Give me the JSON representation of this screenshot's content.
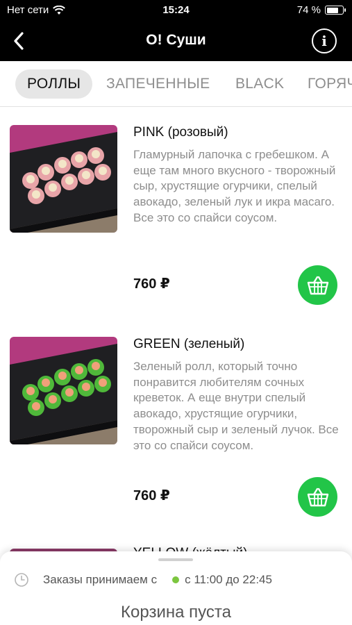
{
  "status_bar": {
    "carrier": "Нет сети",
    "time": "15:24",
    "battery": "74 %",
    "battery_level": 0.74
  },
  "nav": {
    "title": "O! Суши"
  },
  "tabs": [
    {
      "label": "РОЛЛЫ",
      "active": true
    },
    {
      "label": "ЗАПЕЧЕННЫЕ",
      "active": false
    },
    {
      "label": "BLACK",
      "active": false
    },
    {
      "label": "ГОРЯЧ",
      "active": false
    }
  ],
  "products": [
    {
      "name": "PINK (розовый)",
      "description": "Гламурный лапочка с гребешком. А еще там много вкусного - творожный сыр, хрустящие огурчики, спелый авокадо, зеленый лук и икра масаго. Все это со спайси соусом.",
      "price": "760 ₽",
      "roll_color": "#e8a4a8",
      "bg_color": "#b23a7e"
    },
    {
      "name": "GREEN (зеленый)",
      "description": "Зеленый ролл, который точно понравится любителям сочных креветок. А еще внутри спелый авокадо, хрустящие огурчики, творожный сыр и зеленый лучок. Все это со спайси соусом.",
      "price": "760 ₽",
      "roll_color": "#4fb83a",
      "bg_color": "#b23a7e"
    }
  ],
  "peek_product": {
    "name": "YELLOW (жёлтый)"
  },
  "bottom_sheet": {
    "hours_label": "Заказы принимаем с",
    "hours_value": "с 11:00 до 22:45",
    "cart_status": "Корзина пуста"
  },
  "colors": {
    "accent": "#22c548",
    "open_dot": "#7cc63f",
    "header": "#000000"
  }
}
